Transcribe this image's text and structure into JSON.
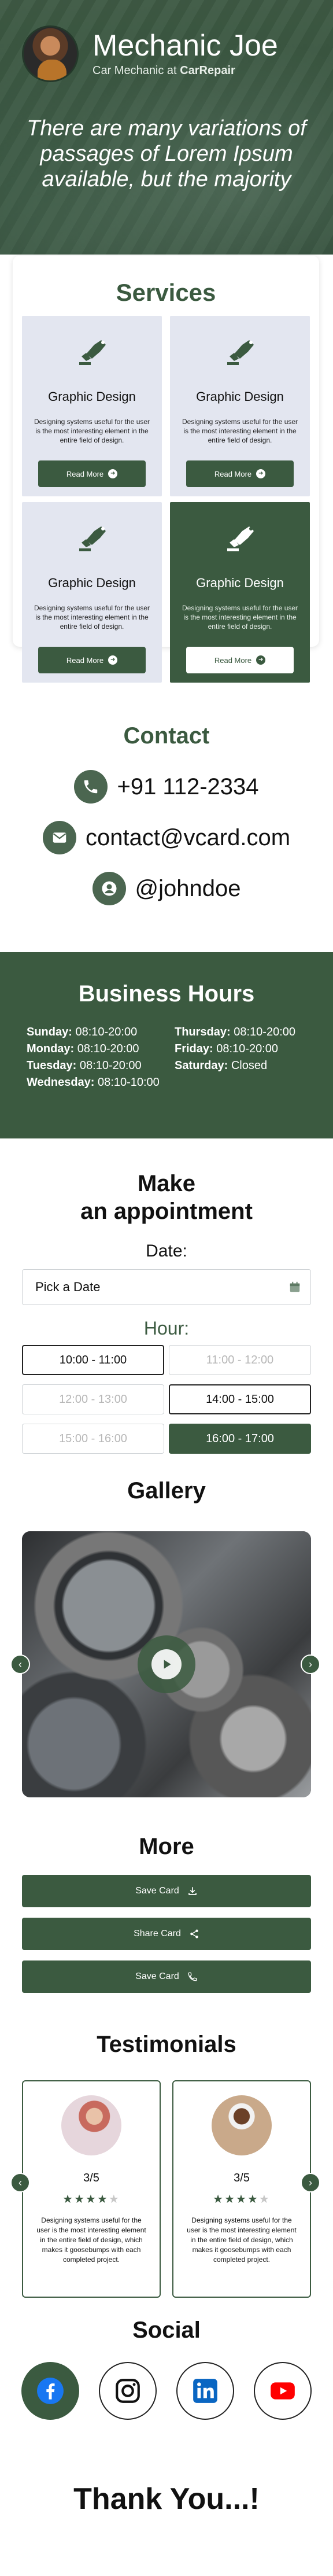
{
  "colors": {
    "accent": "#3b5a40",
    "card_bg": "#e3e6f0",
    "text": "#111111"
  },
  "profile": {
    "name": "Mechanic Joe",
    "role_prefix": "Car Mechanic at",
    "company": "CarRepair"
  },
  "hero": {
    "tagline": "There are many variations of passages of Lorem Ipsum available, but the majority"
  },
  "services": {
    "title": "Services",
    "items": [
      {
        "icon": "paint-brush-icon",
        "title": "Graphic Design",
        "description": "Designing systems useful for the user is the most interesting element in the entire field of design.",
        "button": "Read More"
      },
      {
        "icon": "paint-brush-icon",
        "title": "Graphic Design",
        "description": "Designing systems useful for the user is the most interesting element in the entire field of design.",
        "button": "Read More"
      },
      {
        "icon": "paint-brush-icon",
        "title": "Graphic Design",
        "description": "Designing systems useful for the user is the most interesting element in the entire field of design.",
        "button": "Read More"
      },
      {
        "icon": "paint-brush-icon",
        "title": "Graphic Design",
        "description": "Designing systems useful for the user is the most interesting element in the entire field of design.",
        "button": "Read More",
        "highlighted": true
      }
    ]
  },
  "contact": {
    "title": "Contact",
    "phone": "+91 112-2334",
    "email": "contact@vcard.com",
    "username": "@johndoe"
  },
  "hours": {
    "title": "Business Hours",
    "days": [
      {
        "day": "Sunday:",
        "time": "08:10-20:00"
      },
      {
        "day": "Thursday:",
        "time": "08:10-20:00"
      },
      {
        "day": "Monday:",
        "time": "08:10-20:00"
      },
      {
        "day": "Friday:",
        "time": "08:10-20:00"
      },
      {
        "day": "Tuesday:",
        "time": "08:10-20:00"
      },
      {
        "day": "Saturday:",
        "time": "Closed"
      },
      {
        "day": "Wednesday:",
        "time": "08:10-10:00"
      }
    ]
  },
  "appointment": {
    "title_line1": "Make",
    "title_line2": "an appointment",
    "date_label": "Date:",
    "date_placeholder": "Pick a Date",
    "hour_label": "Hour:",
    "slots": [
      {
        "label": "10:00 - 11:00",
        "state": "available"
      },
      {
        "label": "11:00 - 12:00",
        "state": "disabled"
      },
      {
        "label": "12:00 - 13:00",
        "state": "disabled"
      },
      {
        "label": "14:00 - 15:00",
        "state": "available"
      },
      {
        "label": "15:00 - 16:00",
        "state": "disabled"
      },
      {
        "label": "16:00 - 17:00",
        "state": "selected"
      }
    ]
  },
  "gallery": {
    "title": "Gallery"
  },
  "more": {
    "title": "More",
    "buttons": [
      {
        "label": "Save Card",
        "icon": "download-icon"
      },
      {
        "label": "Share Card",
        "icon": "share-icon"
      },
      {
        "label": "Save Card",
        "icon": "phone-icon"
      }
    ]
  },
  "testimonials": {
    "title": "Testimonials",
    "items": [
      {
        "score": "3/5",
        "rating": 4,
        "description": "Designing systems useful for the user is the most interesting element in the entire field of design, which makes it goosebumps with each completed project."
      },
      {
        "score": "3/5",
        "rating": 4,
        "description": "Designing systems useful for the user is the most interesting element in the entire field of design, which makes it goosebumps with each completed project."
      }
    ]
  },
  "social": {
    "title": "Social",
    "icons": [
      "facebook-icon",
      "instagram-icon",
      "linkedin-icon",
      "youtube-icon"
    ]
  },
  "footer": {
    "thanks": "Thank You...!"
  }
}
